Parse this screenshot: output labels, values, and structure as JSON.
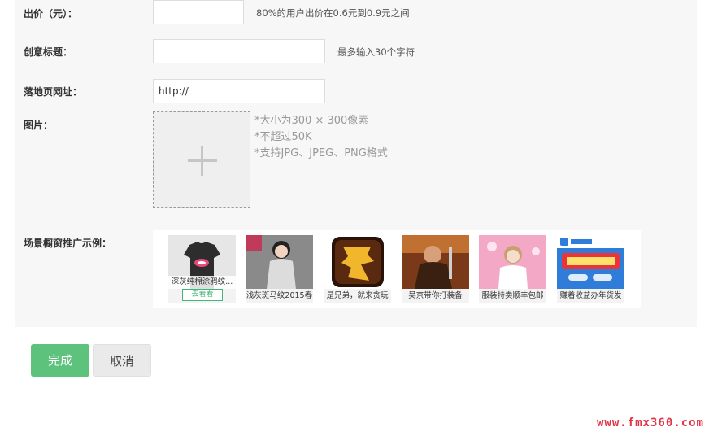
{
  "form": {
    "bid": {
      "label": "出价（元）：",
      "value": "",
      "hint": "80%的用户出价在0.6元到0.9元之间"
    },
    "title": {
      "label": "创意标题：",
      "value": "",
      "hint": "最多输入30个字符"
    },
    "url": {
      "label": "落地页网址：",
      "value": "http://"
    },
    "image": {
      "label": "图片：",
      "rules": [
        "*大小为300 × 300像素",
        "*不超过50K",
        "*支持JPG、JPEG、PNG格式"
      ]
    },
    "examples": {
      "label": "场景橱窗推广示例：",
      "see_label": "去看看",
      "items": [
        {
          "caption": "深灰纯棉涂鸦纹..."
        },
        {
          "caption": "浅灰斑马纹2015春"
        },
        {
          "caption": "是兄弟，就来贪玩"
        },
        {
          "caption": "吴京带你打装备"
        },
        {
          "caption": "服装特卖顺丰包邮"
        },
        {
          "caption": "赚着收益办年货发"
        }
      ]
    }
  },
  "actions": {
    "submit": "完成",
    "cancel": "取消"
  },
  "watermark": "www.fmx360.com",
  "colors": {
    "accent": "#5dc27c",
    "panel": "#f7f7f7"
  }
}
